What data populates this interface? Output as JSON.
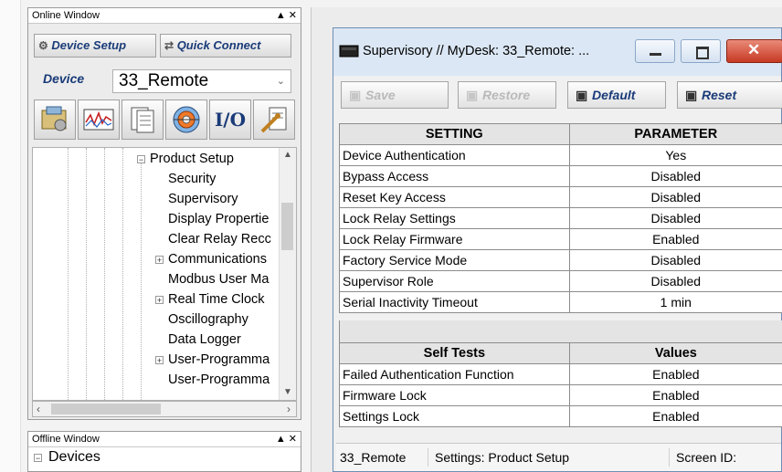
{
  "online_window": {
    "title": "Online Window",
    "title_buttons": "▲ ✕",
    "device_setup_label": "Device Setup",
    "quick_connect_label": "Quick Connect",
    "device_label": "Device",
    "device_value": "33_Remote",
    "io_label": "I/O",
    "tree": {
      "parent": "Product Setup",
      "items": [
        {
          "label": "Security"
        },
        {
          "label": "Supervisory"
        },
        {
          "label": "Display Propertie"
        },
        {
          "label": "Clear Relay Recc"
        },
        {
          "label": "Communications",
          "expandable": true
        },
        {
          "label": "Modbus User Ma"
        },
        {
          "label": "Real Time Clock",
          "expandable": true
        },
        {
          "label": "Oscillography"
        },
        {
          "label": "Data Logger"
        },
        {
          "label": "User-Programma",
          "expandable": true
        },
        {
          "label": "User-Programma"
        }
      ]
    }
  },
  "offline_window": {
    "title": "Offline Window",
    "title_buttons": "▲ ✕",
    "root_item": "Devices"
  },
  "supervisory_window": {
    "title": "Supervisory // MyDesk: 33_Remote: ...",
    "toolbar": {
      "save": "Save",
      "restore": "Restore",
      "default": "Default",
      "reset": "Reset"
    },
    "settings_header": [
      "SETTING",
      "PARAMETER"
    ],
    "settings": [
      [
        "Device Authentication",
        "Yes"
      ],
      [
        "Bypass Access",
        "Disabled"
      ],
      [
        "Reset Key Access",
        "Disabled"
      ],
      [
        "Lock Relay Settings",
        "Disabled"
      ],
      [
        "Lock Relay Firmware",
        "Enabled"
      ],
      [
        "Factory Service Mode",
        "Disabled"
      ],
      [
        "Supervisor Role",
        "Disabled"
      ],
      [
        "Serial Inactivity Timeout",
        "1 min"
      ]
    ],
    "selftests_header": [
      "Self Tests",
      "Values"
    ],
    "selftests": [
      [
        "Failed Authentication Function",
        "Enabled"
      ],
      [
        "Firmware Lock",
        "Enabled"
      ],
      [
        "Settings Lock",
        "Enabled"
      ]
    ],
    "status": {
      "device": "33_Remote",
      "settings": "Settings: Product Setup",
      "screen_id": "Screen ID:"
    }
  },
  "colors": {
    "accent_text": "#1a3b78",
    "close_button": "#d9442f",
    "title_bar": "#dbe7f4"
  }
}
